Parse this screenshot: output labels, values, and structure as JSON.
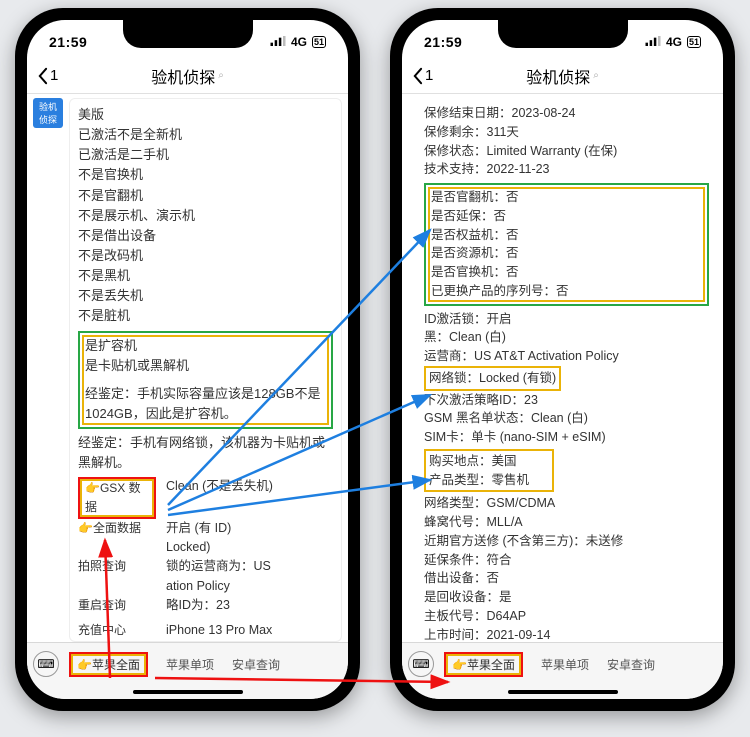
{
  "status": {
    "time": "21:59",
    "net": "4G",
    "batt": "51"
  },
  "nav": {
    "back": "1",
    "title": "验机侦探",
    "sub": "⌕"
  },
  "avatar": "验机\n侦探",
  "left": {
    "lines1": [
      "美版",
      "已激活不是全新机",
      "已激活是二手机",
      "不是官换机",
      "不是官翻机",
      "不是展示机、演示机",
      "不是借出设备",
      "不是改码机",
      "不是黑机",
      "不是丢失机",
      "不是脏机"
    ],
    "box1": [
      "是扩容机",
      "是卡贴机或黑解机",
      "",
      "经鉴定：手机实际容量应该是128GB不是1024GB，因此是扩容机。"
    ],
    "mid": "经鉴定：手机有网络锁，该机器为卡贴机或黑解机。",
    "gsx": "👉GSX 数据",
    "rows": [
      [
        "",
        "Clean (不是丢失机)"
      ],
      [
        "👉全面数据",
        "开启 (有 ID)"
      ],
      [
        "",
        "Locked)"
      ],
      [
        "拍照查询",
        "锁的运营商为：US"
      ],
      [
        "",
        "ation Policy"
      ],
      [
        "重启查询",
        "略ID为：23"
      ],
      [
        "",
        ""
      ],
      [
        "充值中心",
        "iPhone 13 Pro Max"
      ]
    ]
  },
  "right": {
    "top": [
      "保修结束日期：2023-08-24",
      "保修剩余：311天",
      "保修状态：Limited Warranty (在保)",
      "技术支持：2022-11-23"
    ],
    "box1": [
      "是否官翻机：否",
      "是否延保：否",
      "是否权益机：否",
      "是否资源机：否",
      "是否官换机：否",
      "已更换产品的序列号：否"
    ],
    "mid1": [
      "ID激活锁：开启",
      "黑：Clean (白)",
      "运营商：US AT&T Activation Policy"
    ],
    "netlock": "网络锁：Locked (有锁)",
    "mid2": [
      "下次激活策略ID：23",
      "GSM 黑名单状态：Clean (白)",
      "SIM卡：单卡 (nano-SIM + eSIM)"
    ],
    "box2": [
      "购买地点：美国",
      "产品类型：零售机"
    ],
    "tail": [
      "网络类型：GSM/CDMA",
      "蜂窝代号：MLL/A",
      "近期官方送修 (不含第三方)：未送修",
      "延保条件：符合",
      "借出设备：否",
      "是回收设备：是",
      "主板代号：D64AP",
      "上市时间：2021-09-14"
    ]
  },
  "tabs": {
    "t1": "👉苹果全面",
    "t2": "苹果单项",
    "t3": "安卓查询"
  }
}
